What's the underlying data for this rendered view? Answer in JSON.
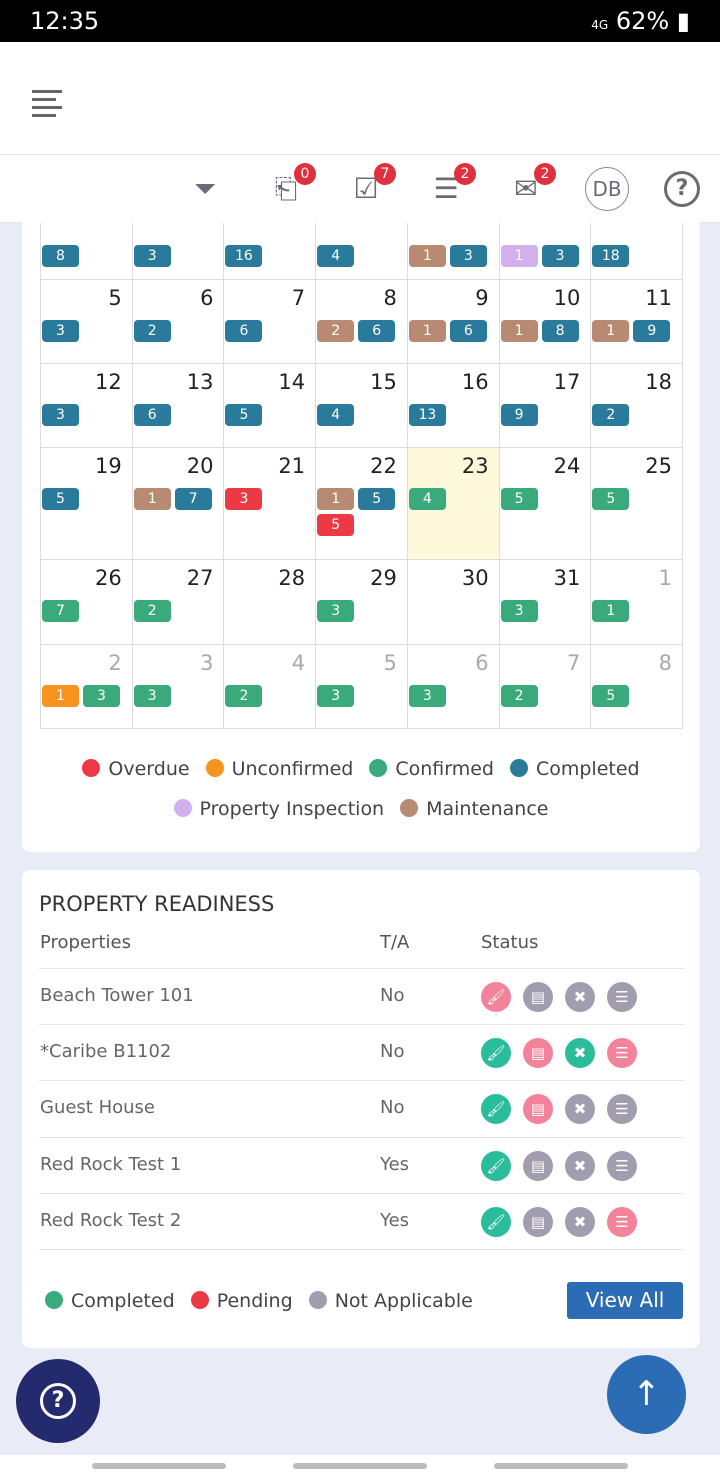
{
  "status_bar": {
    "time": "12:35",
    "battery": "62%",
    "network": "4G"
  },
  "toolbar": {
    "badges": {
      "checkout": "0",
      "tasks": "7",
      "checklist": "2",
      "mail": "2"
    },
    "avatar": "DB"
  },
  "colors": {
    "completed": "#2a7b9b",
    "maintenance": "#b98a72",
    "inspection": "#d2b0ee",
    "overdue": "#ec3a45",
    "unconfirmed": "#f7931e",
    "confirmed": "#3aa97c",
    "ready_green": "#2bbd9b",
    "ready_pink": "#f3839a",
    "ready_grey": "#a29dae"
  },
  "calendar": {
    "weeks": [
      [
        {
          "d": "",
          "b": [
            [
              "completed",
              "8"
            ]
          ]
        },
        {
          "d": "",
          "b": [
            [
              "completed",
              "3"
            ]
          ]
        },
        {
          "d": "",
          "b": [
            [
              "completed",
              "16"
            ]
          ]
        },
        {
          "d": "",
          "b": [
            [
              "completed",
              "4"
            ]
          ]
        },
        {
          "d": "",
          "b": [
            [
              "maintenance",
              "1"
            ],
            [
              "completed",
              "3"
            ]
          ]
        },
        {
          "d": "",
          "b": [
            [
              "inspection",
              "1"
            ],
            [
              "completed",
              "3"
            ]
          ]
        },
        {
          "d": "",
          "b": [
            [
              "completed",
              "18"
            ]
          ]
        }
      ],
      [
        {
          "d": "5",
          "b": [
            [
              "completed",
              "3"
            ]
          ]
        },
        {
          "d": "6",
          "b": [
            [
              "completed",
              "2"
            ]
          ]
        },
        {
          "d": "7",
          "b": [
            [
              "completed",
              "6"
            ]
          ]
        },
        {
          "d": "8",
          "b": [
            [
              "maintenance",
              "2"
            ],
            [
              "completed",
              "6"
            ]
          ]
        },
        {
          "d": "9",
          "b": [
            [
              "maintenance",
              "1"
            ],
            [
              "completed",
              "6"
            ]
          ]
        },
        {
          "d": "10",
          "b": [
            [
              "maintenance",
              "1"
            ],
            [
              "completed",
              "8"
            ]
          ]
        },
        {
          "d": "11",
          "b": [
            [
              "maintenance",
              "1"
            ],
            [
              "completed",
              "9"
            ]
          ]
        }
      ],
      [
        {
          "d": "12",
          "b": [
            [
              "completed",
              "3"
            ]
          ]
        },
        {
          "d": "13",
          "b": [
            [
              "completed",
              "6"
            ]
          ]
        },
        {
          "d": "14",
          "b": [
            [
              "completed",
              "5"
            ]
          ]
        },
        {
          "d": "15",
          "b": [
            [
              "completed",
              "4"
            ]
          ]
        },
        {
          "d": "16",
          "b": [
            [
              "completed",
              "13"
            ]
          ]
        },
        {
          "d": "17",
          "b": [
            [
              "completed",
              "9"
            ]
          ]
        },
        {
          "d": "18",
          "b": [
            [
              "completed",
              "2"
            ]
          ]
        }
      ],
      [
        {
          "d": "19",
          "b": [
            [
              "completed",
              "5"
            ]
          ]
        },
        {
          "d": "20",
          "b": [
            [
              "maintenance",
              "1"
            ],
            [
              "completed",
              "7"
            ]
          ]
        },
        {
          "d": "21",
          "b": [
            [
              "overdue",
              "3"
            ]
          ]
        },
        {
          "d": "22",
          "b": [
            [
              "maintenance",
              "1"
            ],
            [
              "completed",
              "5"
            ],
            [
              "overdue",
              "5"
            ]
          ]
        },
        {
          "d": "23",
          "today": true,
          "b": [
            [
              "confirmed",
              "4"
            ]
          ]
        },
        {
          "d": "24",
          "b": [
            [
              "confirmed",
              "5"
            ]
          ]
        },
        {
          "d": "25",
          "b": [
            [
              "confirmed",
              "5"
            ]
          ]
        }
      ],
      [
        {
          "d": "26",
          "b": [
            [
              "confirmed",
              "7"
            ]
          ]
        },
        {
          "d": "27",
          "b": [
            [
              "confirmed",
              "2"
            ]
          ]
        },
        {
          "d": "28",
          "b": []
        },
        {
          "d": "29",
          "b": [
            [
              "confirmed",
              "3"
            ]
          ]
        },
        {
          "d": "30",
          "b": []
        },
        {
          "d": "31",
          "b": [
            [
              "confirmed",
              "3"
            ]
          ]
        },
        {
          "d": "1",
          "muted": true,
          "b": [
            [
              "confirmed",
              "1"
            ]
          ]
        }
      ],
      [
        {
          "d": "2",
          "muted": true,
          "b": [
            [
              "unconfirmed",
              "1"
            ],
            [
              "confirmed",
              "3"
            ]
          ]
        },
        {
          "d": "3",
          "muted": true,
          "b": [
            [
              "confirmed",
              "3"
            ]
          ]
        },
        {
          "d": "4",
          "muted": true,
          "b": [
            [
              "confirmed",
              "2"
            ]
          ]
        },
        {
          "d": "5",
          "muted": true,
          "b": [
            [
              "confirmed",
              "3"
            ]
          ]
        },
        {
          "d": "6",
          "muted": true,
          "b": [
            [
              "confirmed",
              "3"
            ]
          ]
        },
        {
          "d": "7",
          "muted": true,
          "b": [
            [
              "confirmed",
              "2"
            ]
          ]
        },
        {
          "d": "8",
          "muted": true,
          "b": [
            [
              "confirmed",
              "5"
            ]
          ]
        }
      ]
    ],
    "legend": [
      [
        "overdue",
        "Overdue"
      ],
      [
        "unconfirmed",
        "Unconfirmed"
      ],
      [
        "confirmed",
        "Confirmed"
      ],
      [
        "completed",
        "Completed"
      ],
      [
        "inspection",
        "Property Inspection"
      ],
      [
        "maintenance",
        "Maintenance"
      ]
    ]
  },
  "readiness": {
    "title": "PROPERTY READINESS",
    "headers": {
      "properties": "Properties",
      "ta": "T/A",
      "status": "Status"
    },
    "rows": [
      {
        "name": "Beach Tower 101",
        "ta": "No",
        "status": [
          "pink",
          "grey",
          "grey",
          "grey"
        ]
      },
      {
        "name": "*Caribe B1102",
        "ta": "No",
        "status": [
          "green",
          "pink",
          "green",
          "pink"
        ]
      },
      {
        "name": "Guest House",
        "ta": "No",
        "status": [
          "green",
          "pink",
          "grey",
          "grey"
        ]
      },
      {
        "name": "Red Rock Test 1",
        "ta": "Yes",
        "status": [
          "green",
          "grey",
          "grey",
          "grey"
        ]
      },
      {
        "name": "Red Rock Test 2",
        "ta": "Yes",
        "status": [
          "green",
          "grey",
          "grey",
          "pink"
        ]
      }
    ],
    "legend": {
      "completed": "Completed",
      "pending": "Pending",
      "na": "Not Applicable"
    },
    "view_all": "View All"
  }
}
